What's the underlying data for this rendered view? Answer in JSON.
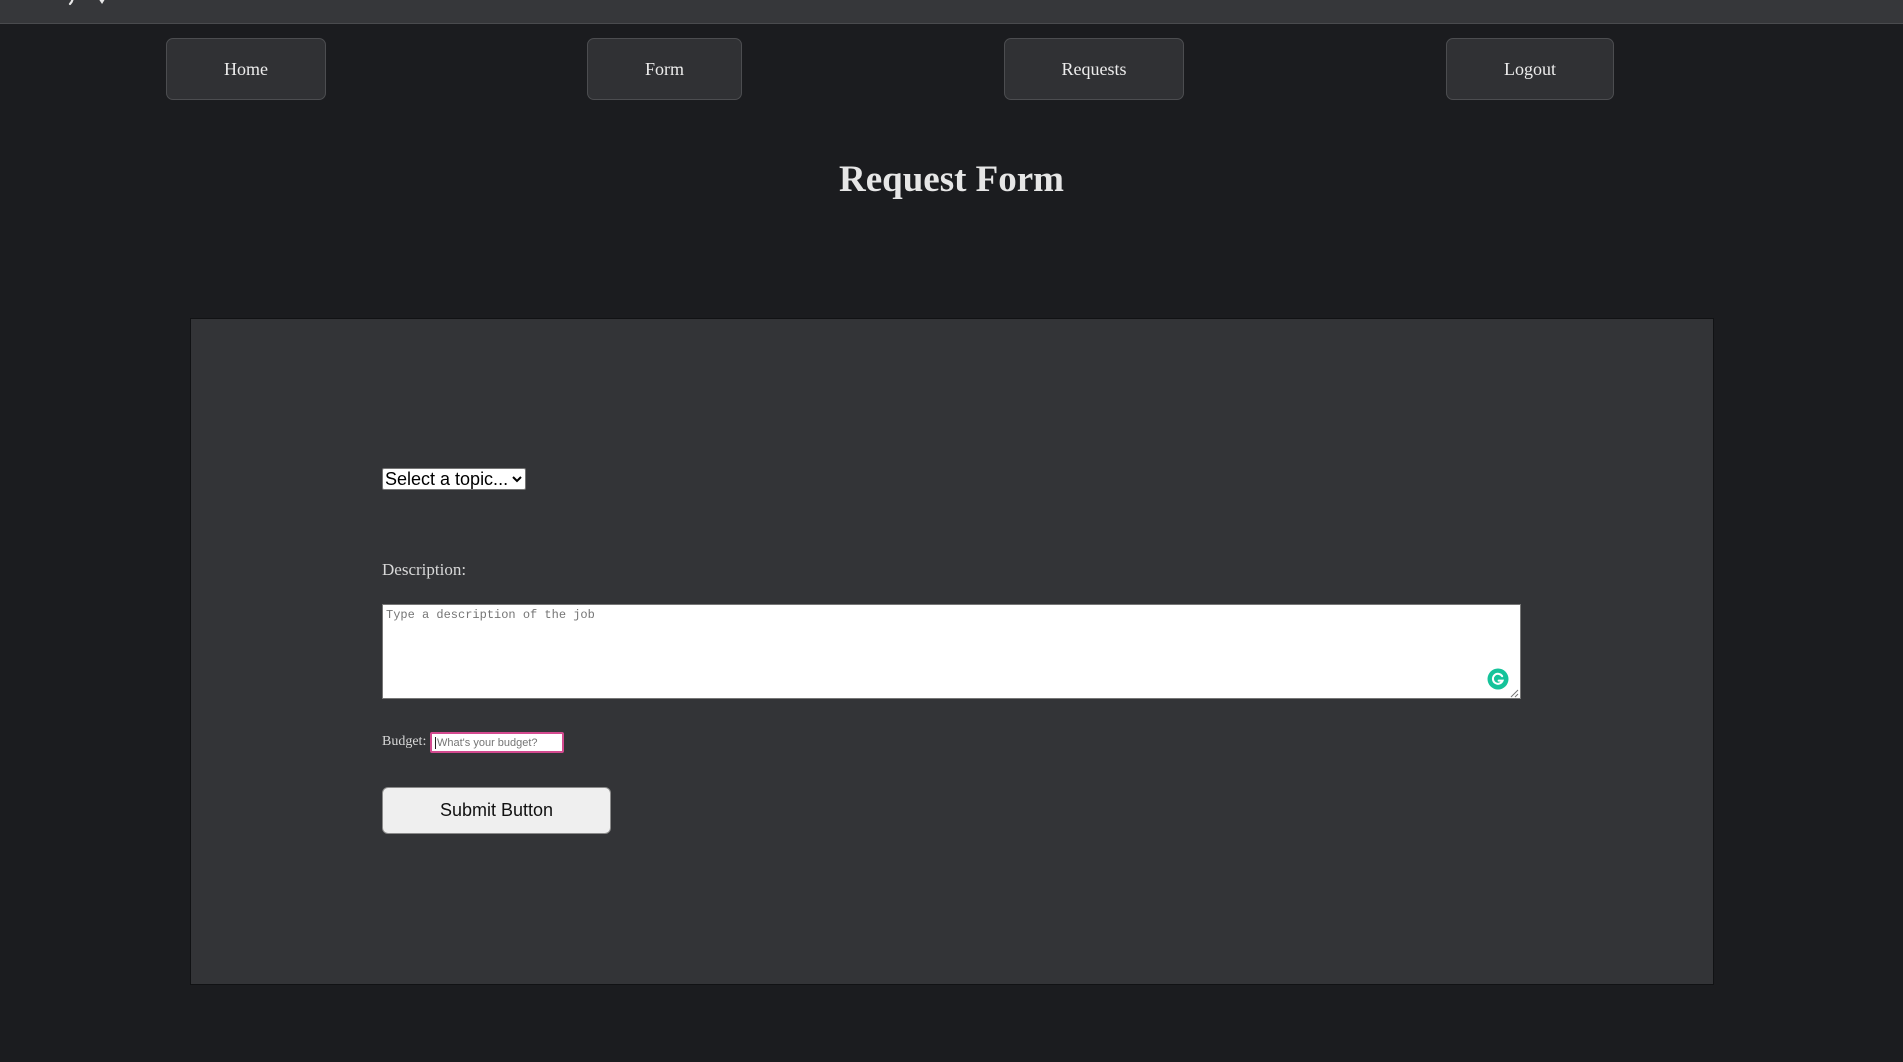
{
  "nav": {
    "home_label": "Home",
    "form_label": "Form",
    "requests_label": "Requests",
    "logout_label": "Logout"
  },
  "page": {
    "title": "Request Form"
  },
  "form": {
    "topic_select": {
      "selected": "Select a topic...",
      "icon": "chevron-down-icon"
    },
    "description": {
      "label": "Description:",
      "placeholder": "Type a description of the job"
    },
    "budget": {
      "label": "Budget:",
      "placeholder": "What's your budget?"
    },
    "submit_label": "Submit Button"
  },
  "colors": {
    "page_background": "#1b1c1f",
    "panel_background": "#333437",
    "nav_button_background": "#303134",
    "budget_focus_border": "#d34a8f",
    "grammarly_green": "#15c39a"
  }
}
